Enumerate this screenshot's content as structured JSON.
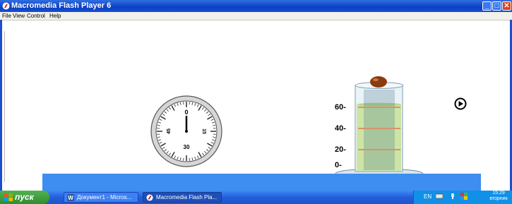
{
  "window": {
    "title": "Macromedia Flash Player 6",
    "icon": "flash-player-icon",
    "controls": {
      "minimize": "_",
      "maximize": "□",
      "close": "✕"
    }
  },
  "menu": {
    "items": [
      "File",
      "View",
      "Control",
      "Help"
    ]
  },
  "stage": {
    "stopwatch": {
      "dial_labels": [
        "0",
        "15",
        "30",
        "45"
      ]
    },
    "cylinder": {
      "scale_labels": [
        "60-",
        "40-",
        "20-",
        "0-"
      ]
    },
    "play_button": {
      "icon": "play-icon"
    },
    "ball": {
      "icon": "ball-icon"
    }
  },
  "taskbar": {
    "start_label": "пуск",
    "tasks": [
      {
        "label": "Документ1 - Micros...",
        "icon": "word-icon"
      },
      {
        "label": "Macromedia Flash Pla...",
        "icon": "flash-player-icon"
      }
    ],
    "language": "EN",
    "clock_time": "15:29",
    "clock_day": "вторник"
  },
  "colors": {
    "titlebar": "#0a3fc2",
    "water": "#3d8ef0",
    "liquid": "#cde4a6",
    "taskbar": "#235ed8",
    "start": "#2f8e2f"
  }
}
